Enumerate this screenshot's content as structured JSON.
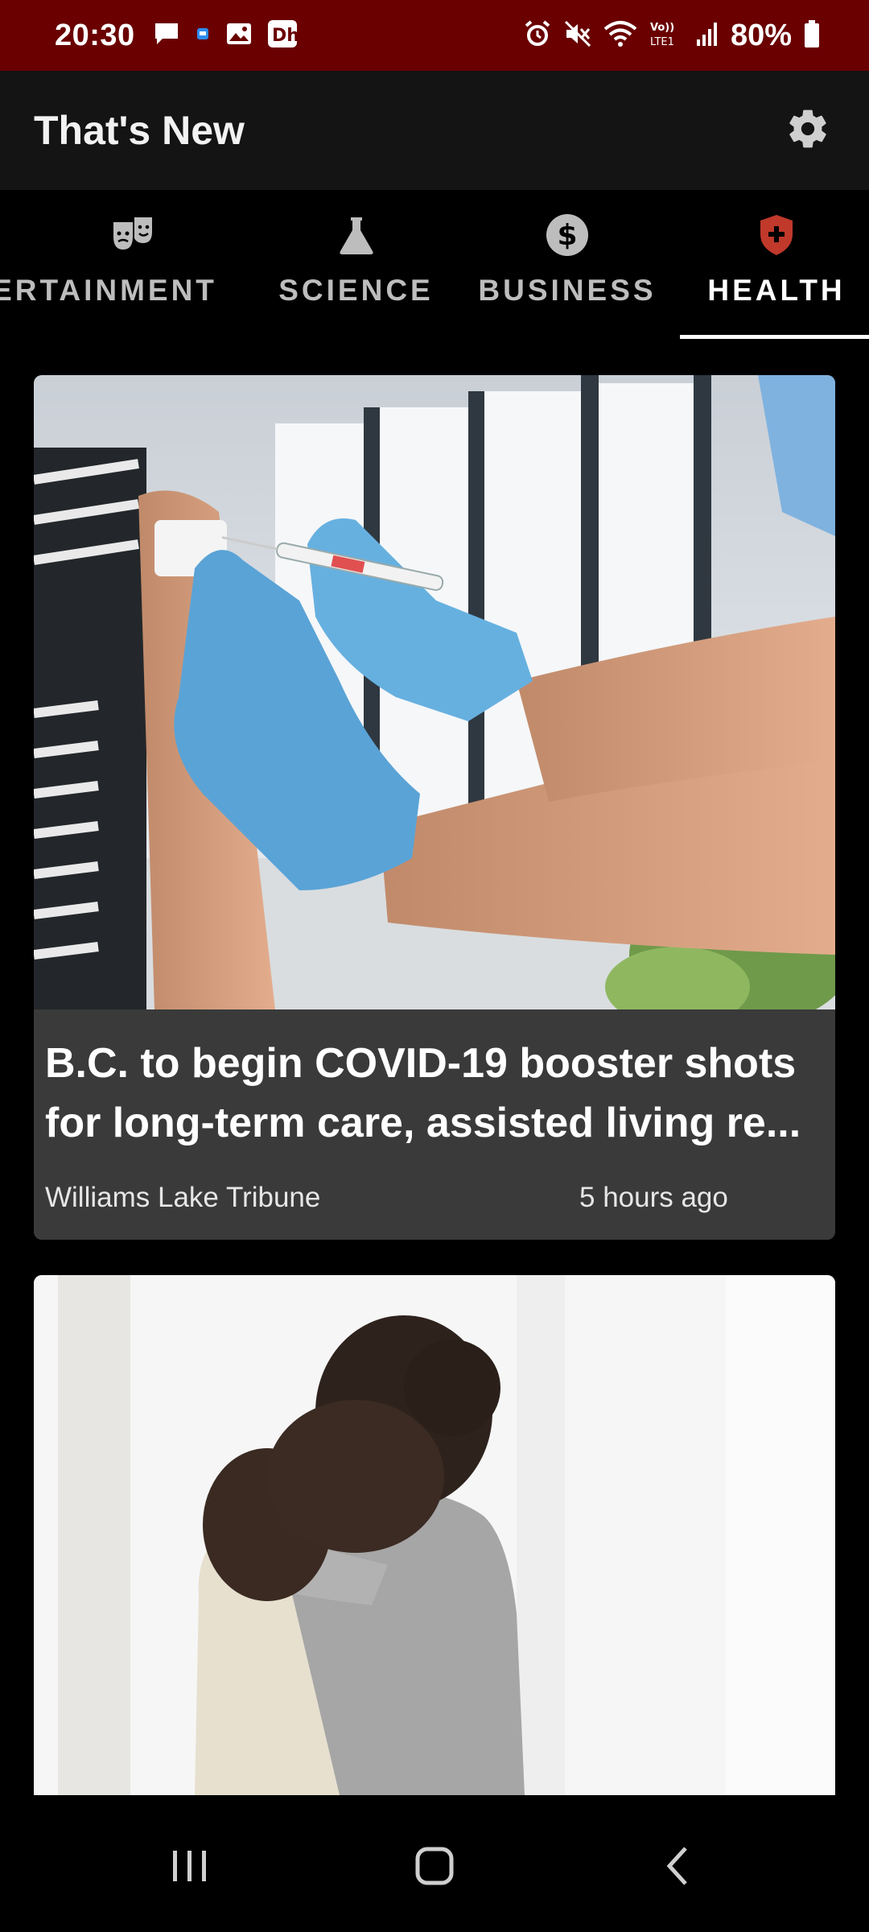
{
  "status_bar": {
    "time": "20:30",
    "battery_percent": "80%",
    "left_icons": [
      "chat-icon",
      "app-notification-icon",
      "gallery-icon",
      "dh-app-icon"
    ],
    "right_icons": [
      "alarm-icon",
      "mute-icon",
      "wifi-icon",
      "volte-icon",
      "signal-icon",
      "battery-icon"
    ],
    "volte_label": "Vo)) LTE1"
  },
  "app_bar": {
    "title": "That's New",
    "settings_icon": "gear-icon"
  },
  "tabs": [
    {
      "label": "ENTERTAINMENT",
      "visible_label": "ERTAINMENT",
      "icon": "theater-masks-icon",
      "active": false
    },
    {
      "label": "SCIENCE",
      "icon": "flask-icon",
      "active": false
    },
    {
      "label": "BUSINESS",
      "icon": "dollar-icon",
      "active": false
    },
    {
      "label": "HEALTH",
      "icon": "shield-plus-icon",
      "active": true
    }
  ],
  "colors": {
    "status_bar_bg": "#6a0000",
    "app_bar_bg": "#141414",
    "card_bg": "#3a3a3a",
    "health_icon": "#c0392b",
    "tab_inactive": "#bdbdbd",
    "tab_active": "#ffffff"
  },
  "articles": [
    {
      "headline": "B.C. to begin COVID-19 booster shots for long-term care, assisted living re...",
      "source": "Williams Lake Tribune",
      "time": "5 hours ago",
      "image": "vaccination-photo"
    },
    {
      "headline": "",
      "image": "two-people-hugging-photo"
    }
  ],
  "nav_bar": {
    "buttons": [
      "recents-icon",
      "home-icon",
      "back-icon"
    ]
  }
}
